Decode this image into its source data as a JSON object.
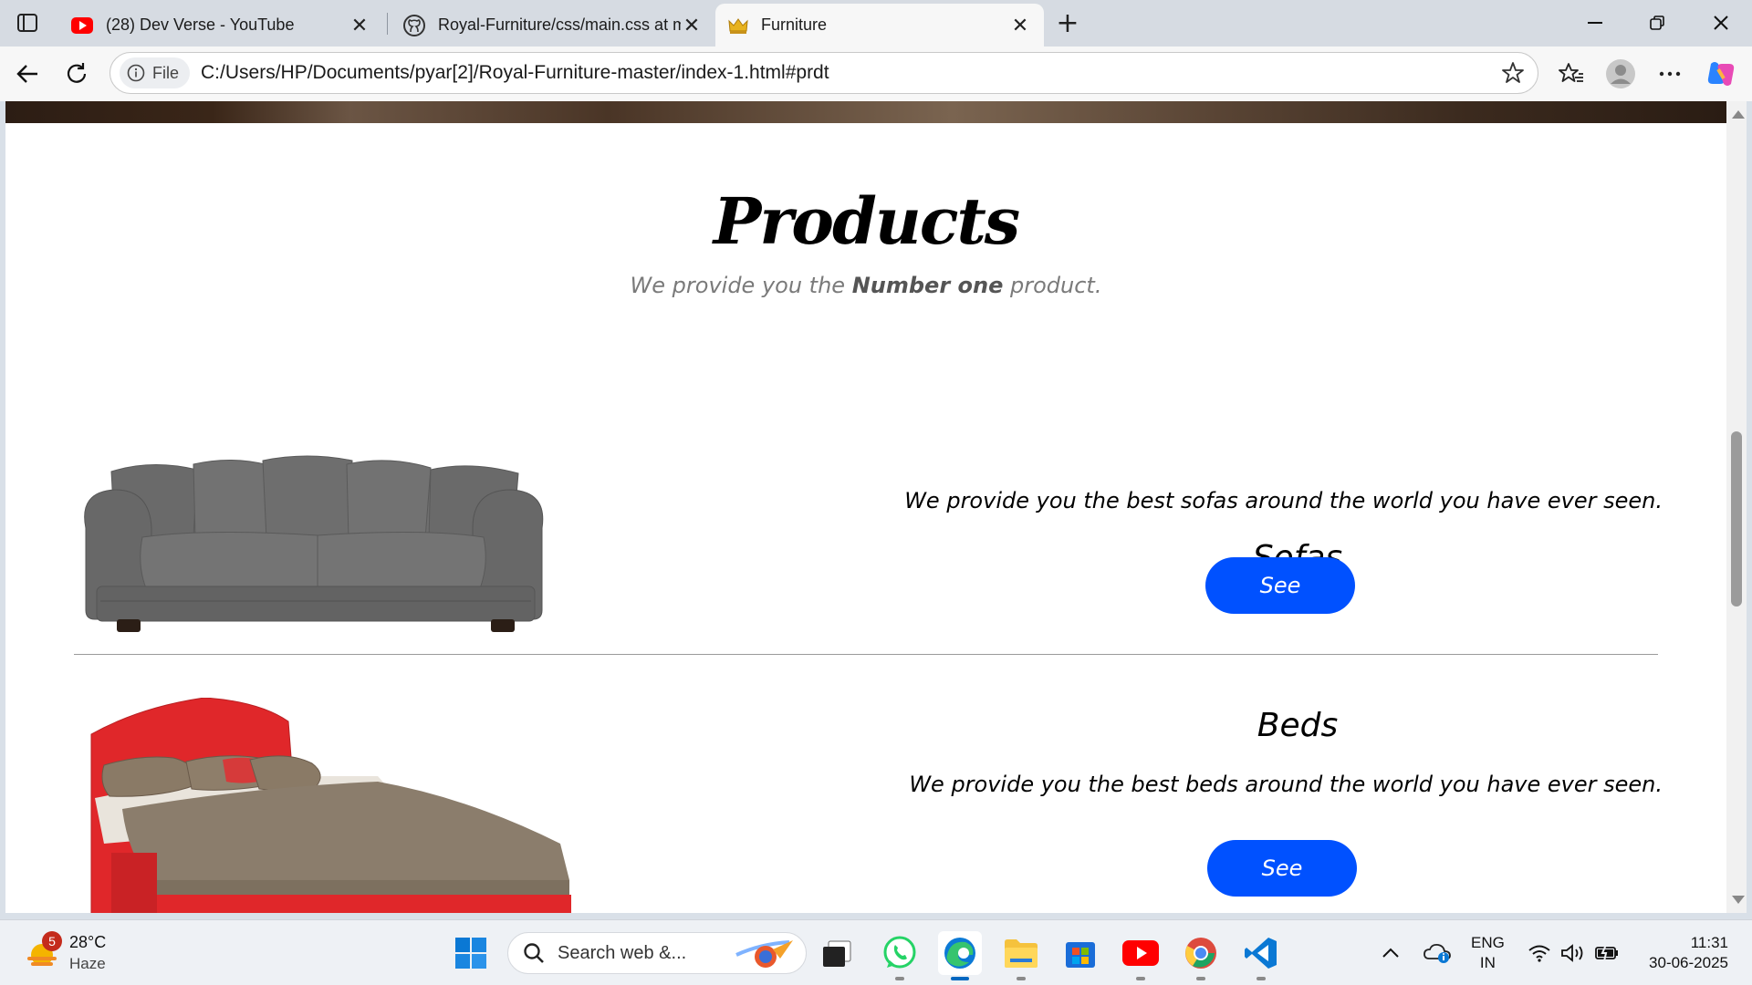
{
  "browser": {
    "tabs": [
      {
        "label": "(28) Dev Verse - YouTube",
        "icon": "youtube-icon",
        "active": false
      },
      {
        "label": "Royal-Furniture/css/main.css at m",
        "icon": "github-icon",
        "active": false
      },
      {
        "label": "Furniture",
        "icon": "crown-icon",
        "active": true
      }
    ],
    "address": {
      "chip_label": "File",
      "url": "C:/Users/HP/Documents/pyar[2]/Royal-Furniture-master/index-1.html#prdt"
    }
  },
  "page": {
    "section_title": "Products",
    "section_subtitle": {
      "pre": "We provide you the ",
      "bold": "Number one",
      "post": " product."
    },
    "products": [
      {
        "name": "Sofas",
        "description": "We provide you the best sofas around the world you have ever seen.",
        "button_label": "See"
      },
      {
        "name": "Beds",
        "description": "We provide you the best beds around the world you have ever seen.",
        "button_label": "See"
      }
    ],
    "colors": {
      "button": "#0051ff",
      "bed_frame": "#e0272a",
      "sofa": "#6b6b6b"
    }
  },
  "taskbar": {
    "weather": {
      "badge": "5",
      "temp": "28°C",
      "condition": "Haze"
    },
    "search_placeholder": "Search web &...",
    "apps": [
      "start-icon",
      "search-icon",
      "task-view-icon",
      "whatsapp-icon",
      "edge-icon",
      "file-explorer-icon",
      "microsoft-store-icon",
      "youtube-icon",
      "chrome-icon",
      "vscode-icon"
    ],
    "tray": {
      "lang_line1": "ENG",
      "lang_line2": "IN",
      "time": "11:31",
      "date": "30-06-2025"
    }
  }
}
